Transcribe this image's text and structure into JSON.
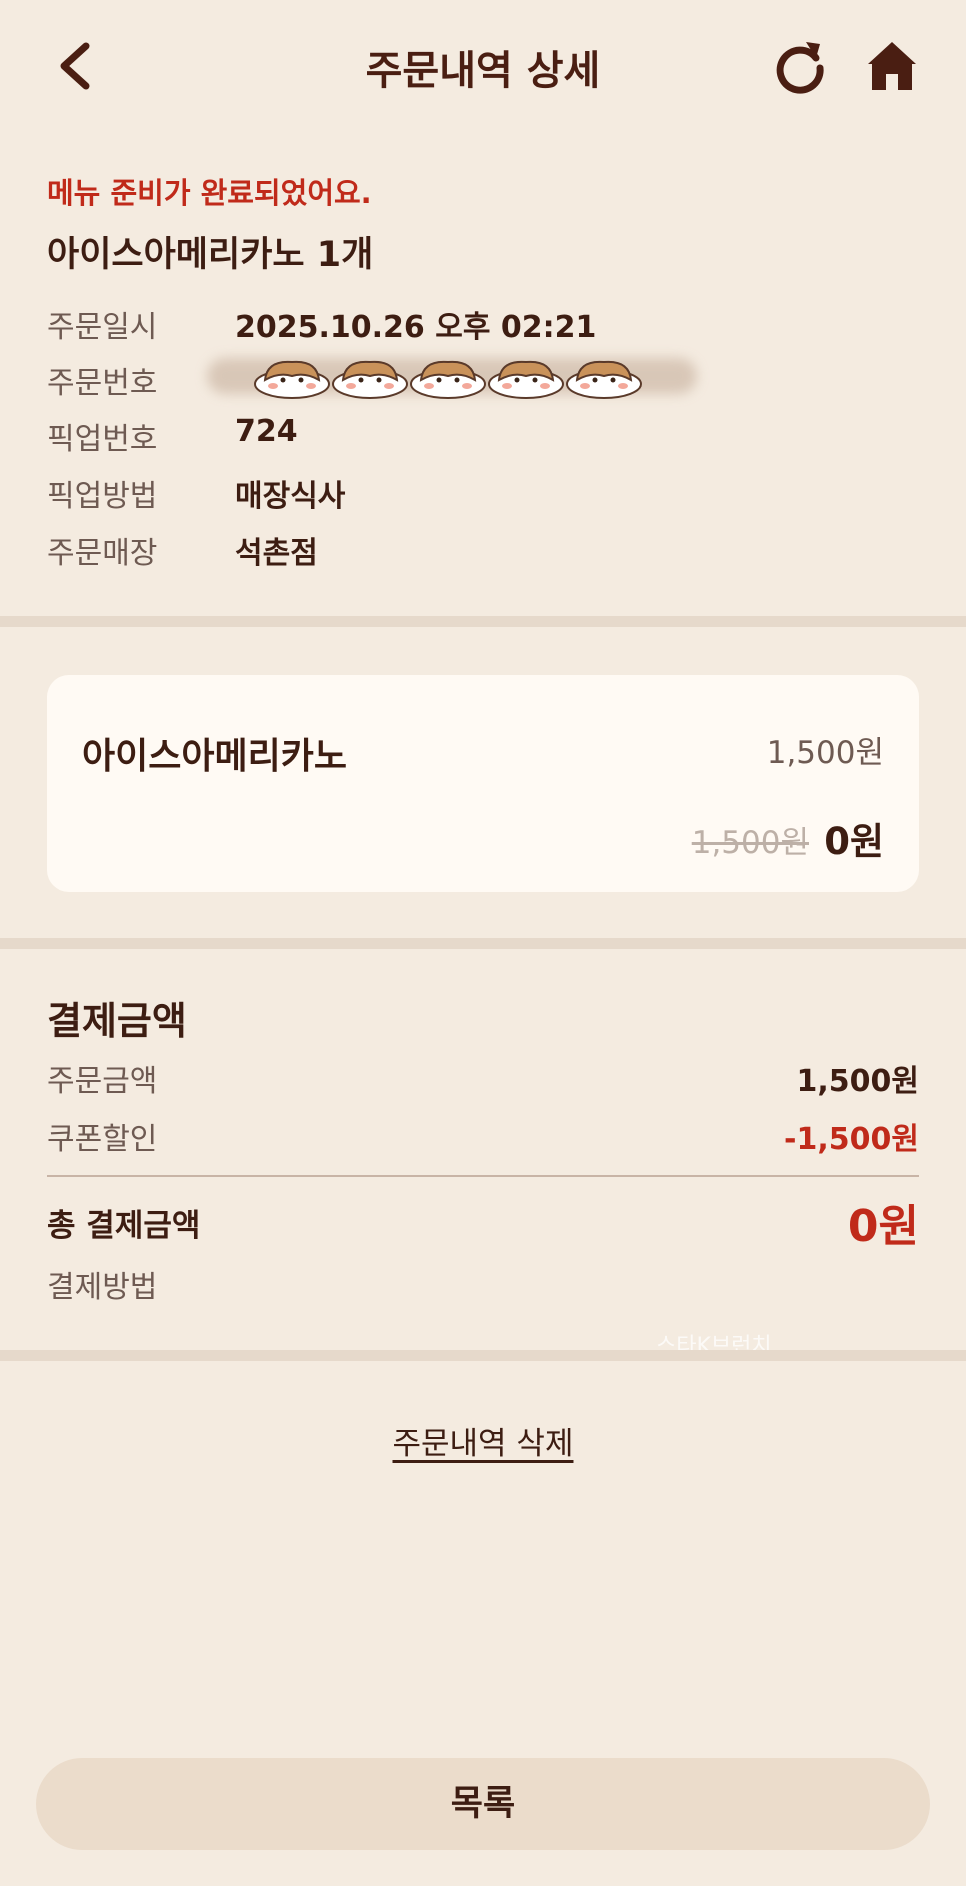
{
  "header": {
    "title": "주문내역 상세",
    "back_icon": "chevron-left-icon",
    "refresh_icon": "refresh-icon",
    "home_icon": "home-icon"
  },
  "order": {
    "status": "메뉴 준비가 완료되었어요.",
    "summary": "아이스아메리카노 1개",
    "info": [
      {
        "label": "주문일시",
        "value": "2025.10.26 오후 02:21"
      },
      {
        "label": "주문번호",
        "value": ""
      },
      {
        "label": "픽업번호",
        "value": "724"
      },
      {
        "label": "픽업방법",
        "value": "매장식사"
      },
      {
        "label": "주문매장",
        "value": "석촌점"
      }
    ]
  },
  "item": {
    "name": "아이스아메리카노",
    "price": "1,500원",
    "original_price": "1,500원",
    "final_price": "0원"
  },
  "payment": {
    "title": "결제금액",
    "rows": [
      {
        "label": "주문금액",
        "value": "1,500원"
      },
      {
        "label": "쿠폰할인",
        "value": "-1,500원"
      }
    ],
    "total_label": "총 결제금액",
    "total_value": "0원",
    "method_label": "결제방법"
  },
  "watermark": "스타K브런치",
  "actions": {
    "delete_label": "주문내역 삭제",
    "list_label": "목록"
  },
  "colors": {
    "background": "#f4ebe0",
    "accent_red": "#c02a1a",
    "text_dark": "#3d1d12",
    "card": "#fffaf4"
  }
}
